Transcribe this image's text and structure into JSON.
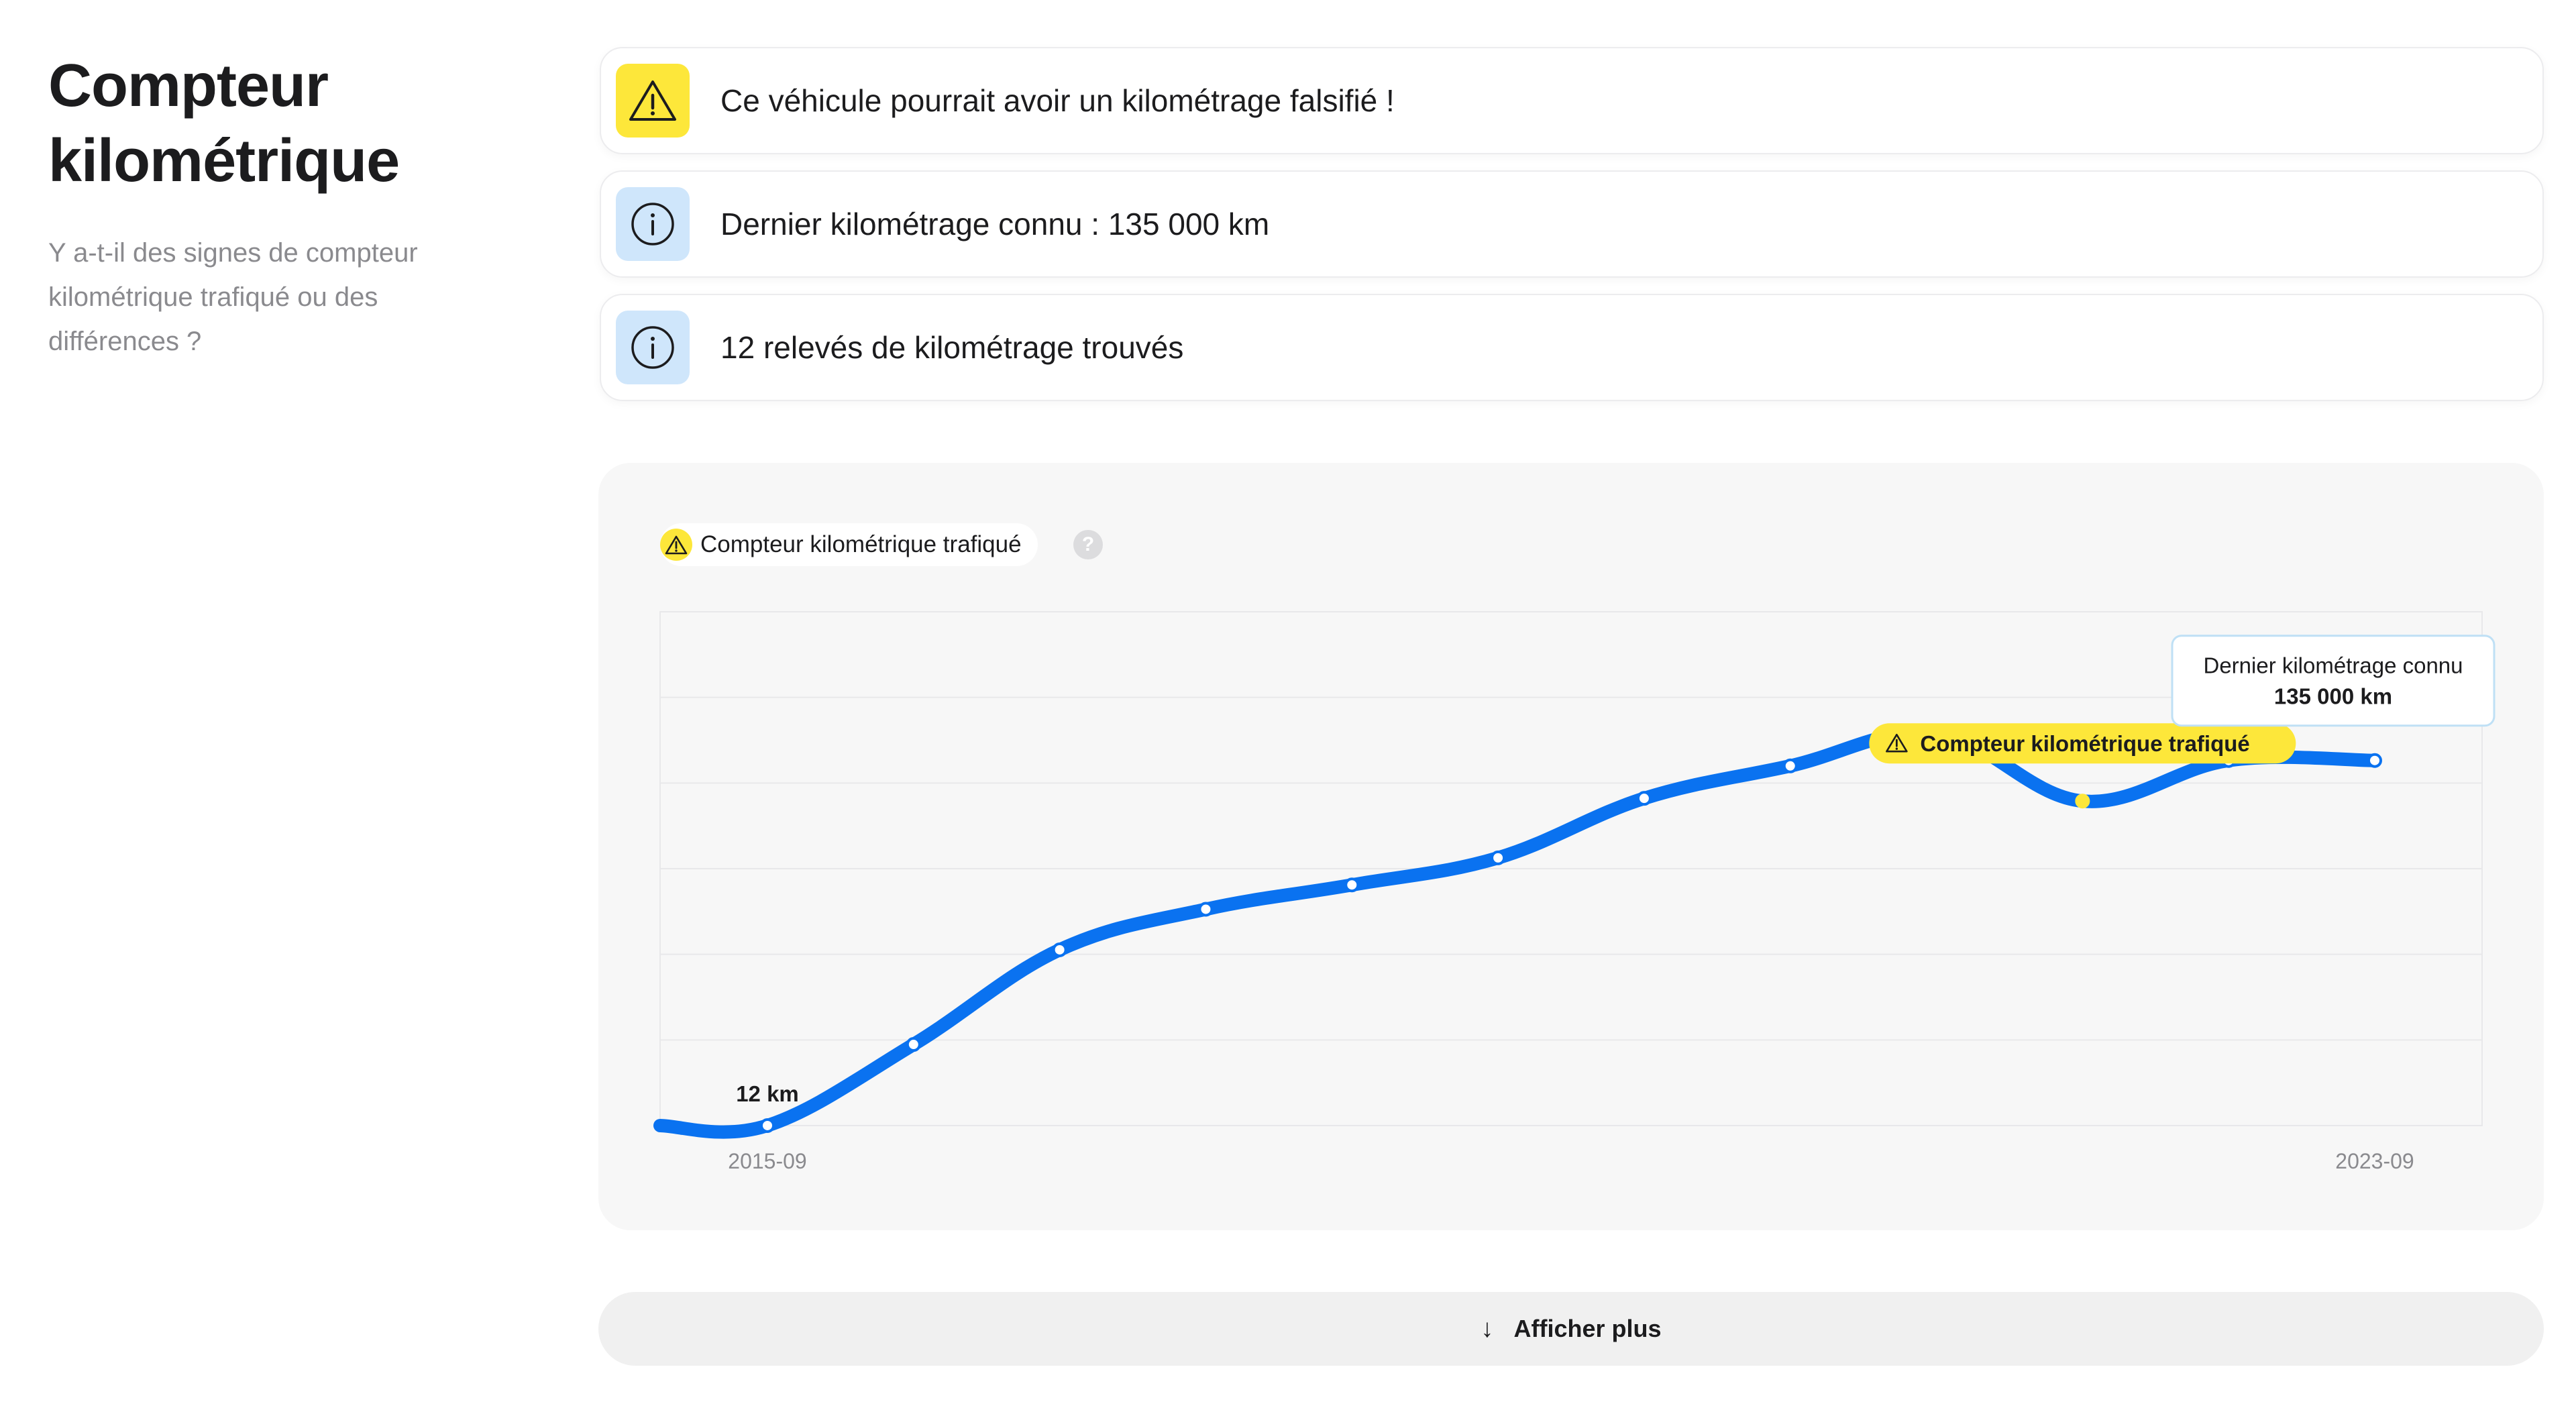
{
  "section": {
    "title": "Compteur kilométrique",
    "subtitle": "Y a-t-il des signes de compteur kilométrique trafiqué ou des différences ?"
  },
  "alerts": [
    {
      "type": "warning",
      "icon": "warning-triangle-icon",
      "text": "Ce véhicule pourrait avoir un kilométrage falsifié !"
    },
    {
      "type": "info",
      "icon": "info-circle-icon",
      "text": "Dernier kilométrage connu : 135 000 km"
    },
    {
      "type": "info",
      "icon": "info-circle-icon",
      "text": "12 relevés de kilométrage trouvés"
    }
  ],
  "chart": {
    "legend_label": "Compteur kilométrique trafiqué",
    "help_label": "?",
    "first_point_label": "12 km",
    "tamper_label": "Compteur kilométrique trafiqué",
    "last_label_title": "Dernier kilométrage connu",
    "last_label_value": "135 000 km"
  },
  "chart_data": {
    "type": "line",
    "xlabel": "",
    "ylabel": "",
    "x_tick_labels": [
      "2015-09",
      "2023-09"
    ],
    "x": [
      "2015-09",
      "2016-06",
      "2017-03",
      "2017-12",
      "2018-09",
      "2019-06",
      "2020-03",
      "2020-12",
      "2021-09",
      "2022-06",
      "2023-03",
      "2023-09"
    ],
    "values": [
      12,
      30000,
      65000,
      80000,
      89000,
      99000,
      121000,
      133000,
      145000,
      120000,
      135000,
      135000
    ],
    "ylim": [
      0,
      190000
    ],
    "tampered_index": 9,
    "line_color": "#0a72f0",
    "tamper_color": "#fde73a",
    "grid": true
  },
  "more_button": {
    "label": "Afficher plus"
  }
}
